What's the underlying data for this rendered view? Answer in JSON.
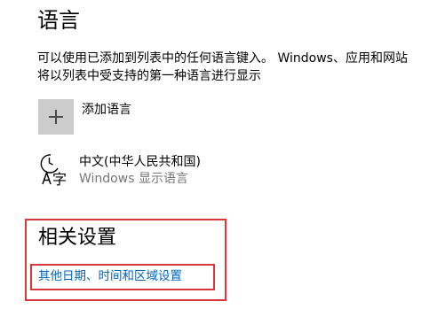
{
  "language_section": {
    "title": "语言",
    "description_line1": "可以使用已添加到列表中的任何语言键入。 Windows、应用和网站",
    "description_line2": "将以列表中受支持的第一种语言进行显示",
    "add_language_label": "添加语言",
    "add_language_icon": "plus-icon",
    "languages": [
      {
        "name": "中文(中华人民共和国)",
        "subtitle": "Windows 显示语言",
        "icon": "language-display-icon"
      }
    ]
  },
  "related_settings": {
    "title": "相关设置",
    "link_label": "其他日期、时间和区域设置",
    "highlight_color": "#d8383a",
    "link_color": "#0067b8"
  }
}
